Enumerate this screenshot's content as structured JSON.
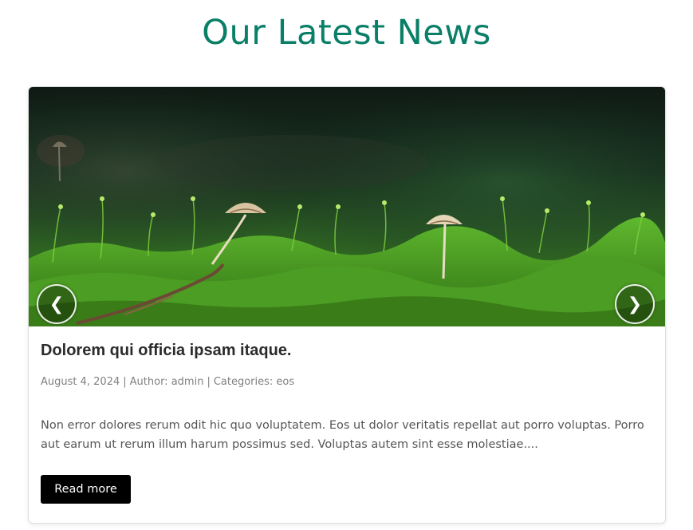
{
  "section": {
    "title": "Our Latest News"
  },
  "slider": {
    "prev_label": "❮",
    "next_label": "❯",
    "prev_icon": "chevron-left-icon",
    "next_icon": "chevron-right-icon"
  },
  "post": {
    "title": "Dolorem qui officia ipsam itaque.",
    "date": "August 4, 2024",
    "author_label": "Author:",
    "author": "admin",
    "categories_label": "Categories:",
    "category": "eos",
    "separator": "|",
    "excerpt": "Non error dolores rerum odit hic quo voluptatem. Eos ut dolor veritatis repellat aut porro voluptas. Porro aut earum ut rerum illum harum possimus sed. Voluptas autem sint esse molestiae....",
    "read_more_label": "Read more"
  },
  "colors": {
    "title_accent": "#0a7f68",
    "button_bg": "#000000",
    "meta_text": "#808080"
  }
}
